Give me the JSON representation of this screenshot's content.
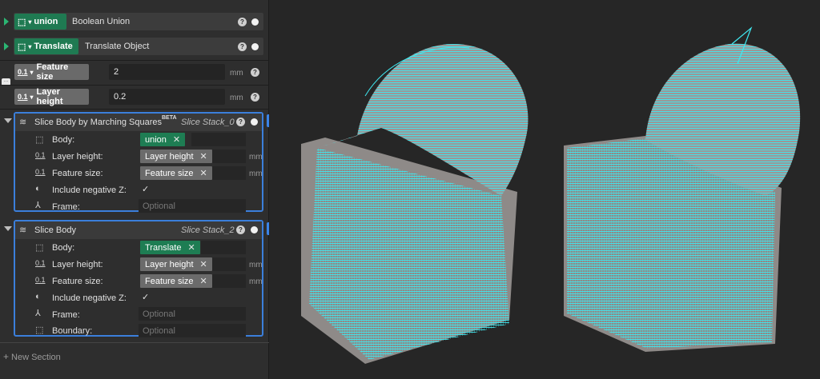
{
  "colors": {
    "accent": "#3b7fdb",
    "green": "#1f7a52",
    "mesh": "#3fe8f0"
  },
  "rows": {
    "union": {
      "chip": "union",
      "title": "Boolean Union"
    },
    "translate": {
      "chip": "Translate",
      "title": "Translate Object"
    },
    "feature_size": {
      "type": "0.1",
      "label": "Feature size",
      "value": "2",
      "unit": "mm"
    },
    "layer_height": {
      "type": "0.1",
      "label": "Layer height",
      "value": "0.2",
      "unit": "mm"
    }
  },
  "help_glyph": "?",
  "sec1": {
    "title": "Slice Body by Marching Squares",
    "beta": "BETA",
    "output": "Slice Stack_0",
    "body_label": "Body:",
    "body_value": "union",
    "layer_label": "Layer height:",
    "layer_value": "Layer height",
    "feature_label": "Feature size:",
    "feature_value": "Feature size",
    "neg_label": "Include negative Z:",
    "frame_label": "Frame:",
    "frame_placeholder": "Optional",
    "unit": "mm",
    "check": "✓",
    "x": "✕"
  },
  "sec2": {
    "title": "Slice Body",
    "output": "Slice Stack_2",
    "body_label": "Body:",
    "body_value": "Translate",
    "layer_label": "Layer height:",
    "layer_value": "Layer height",
    "feature_label": "Feature size:",
    "feature_value": "Feature size",
    "neg_label": "Include negative Z:",
    "frame_label": "Frame:",
    "frame_placeholder": "Optional",
    "boundary_label": "Boundary:",
    "boundary_placeholder": "Optional",
    "unit": "mm",
    "check": "✓",
    "x": "✕"
  },
  "new_section": "New Section",
  "plus_glyph": "+",
  "type_badge": "0.1",
  "icons": [
    "cube-icon",
    "chevron-down-icon",
    "numeric-icon",
    "help-icon",
    "visibility-dot-icon",
    "comment-icon",
    "contrast-icon",
    "axes-icon",
    "layers-icon",
    "plus-icon"
  ]
}
